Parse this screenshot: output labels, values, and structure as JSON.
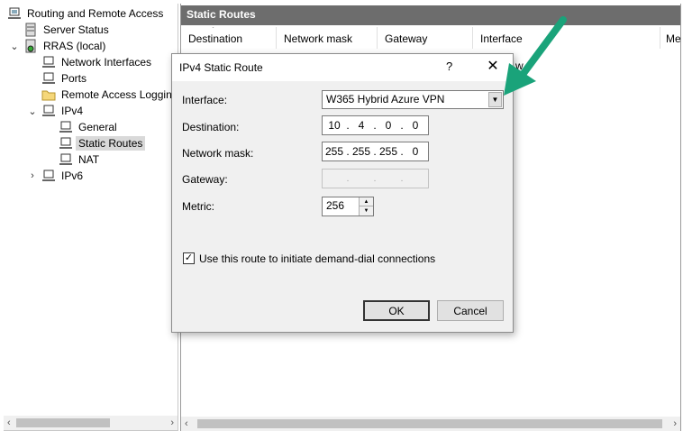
{
  "tree": {
    "root": "Routing and Remote Access",
    "items": [
      {
        "label": "Server Status"
      },
      {
        "label": "RRAS (local)"
      },
      {
        "label": "Network Interfaces"
      },
      {
        "label": "Ports"
      },
      {
        "label": "Remote Access Logging"
      },
      {
        "label": "IPv4"
      },
      {
        "label": "General"
      },
      {
        "label": "Static Routes"
      },
      {
        "label": "NAT"
      },
      {
        "label": "IPv6"
      }
    ]
  },
  "pane": {
    "title": "Static Routes",
    "columns": [
      "Destination",
      "Network mask",
      "Gateway",
      "Interface",
      "Me"
    ],
    "partial_text": "w"
  },
  "dialog": {
    "title": "IPv4 Static Route",
    "help": "?",
    "close": "✕",
    "interface_label": "Interface:",
    "interface_value": "W365 Hybrid Azure VPN",
    "destination_label": "Destination:",
    "destination": [
      "10",
      "4",
      "0",
      "0"
    ],
    "mask_label": "Network mask:",
    "mask": [
      "255",
      "255",
      "255",
      "0"
    ],
    "gateway_label": "Gateway:",
    "metric_label": "Metric:",
    "metric": "256",
    "checkbox_label": "Use this route to initiate demand-dial connections",
    "checkbox_checked": "✓",
    "ok": "OK",
    "cancel": "Cancel"
  },
  "scroll": {
    "left": "‹",
    "right": "›"
  },
  "colors": {
    "arrow": "#1aa37a",
    "title_bar": "#6d6d6d"
  }
}
